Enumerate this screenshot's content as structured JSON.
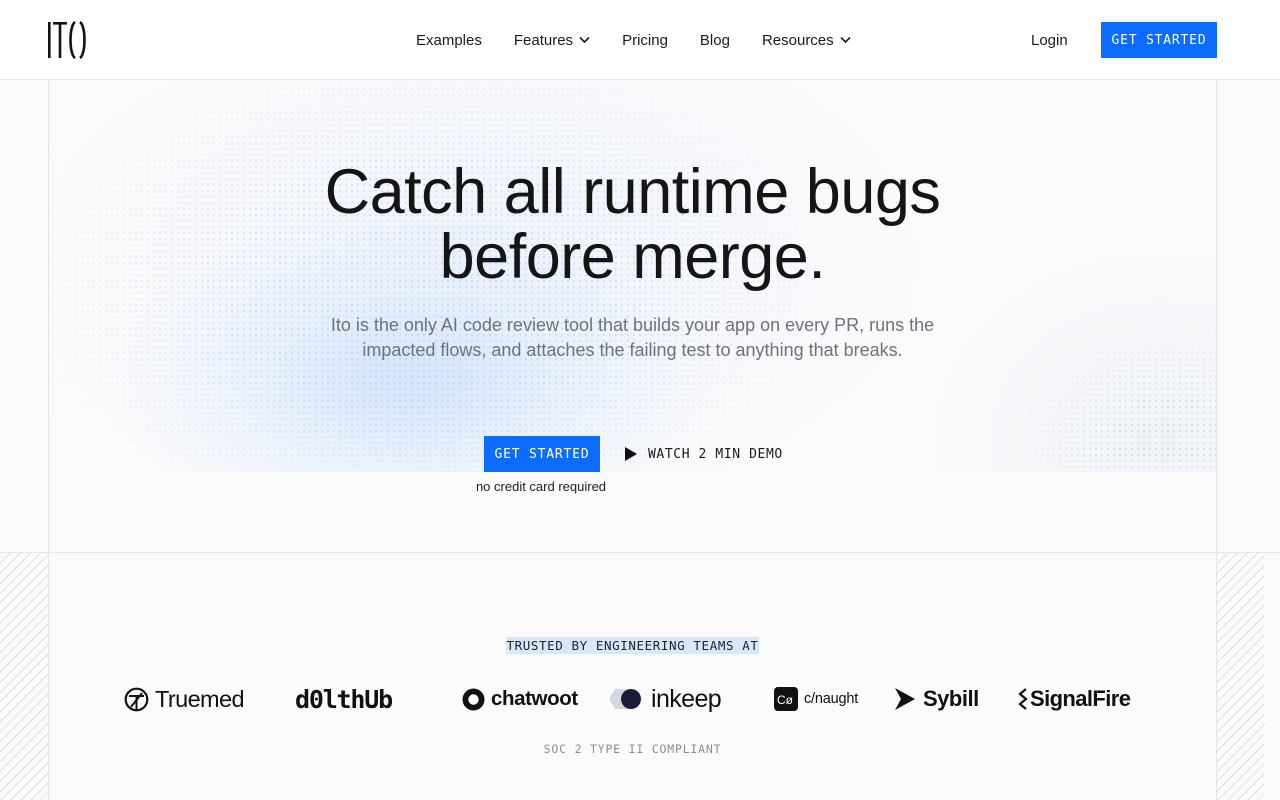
{
  "brand": {
    "logo_text": "ITO"
  },
  "nav": {
    "items": [
      {
        "label": "Examples",
        "has_dropdown": false
      },
      {
        "label": "Features",
        "has_dropdown": true
      },
      {
        "label": "Pricing",
        "has_dropdown": false
      },
      {
        "label": "Blog",
        "has_dropdown": false
      },
      {
        "label": "Resources",
        "has_dropdown": true
      }
    ],
    "login_label": "Login",
    "cta_label": "GET STARTED"
  },
  "hero": {
    "headline_line1": "Catch all runtime bugs",
    "headline_line2": "before merge.",
    "subheadline": "Ito is the only AI code review tool that builds your app on every PR, runs the impacted flows, and attaches the failing test to anything that breaks.",
    "cta_label": "GET STARTED",
    "demo_label": "WATCH 2 MIN DEMO",
    "note": "no credit card required"
  },
  "trusted": {
    "label": "TRUSTED BY ENGINEERING TEAMS AT",
    "logos": [
      {
        "name": "Truemed",
        "icon": "truemed-logo-icon"
      },
      {
        "name": "d0lthUb",
        "icon": "dolthub-wordmark"
      },
      {
        "name": "chatwoot",
        "icon": "chatwoot-logo-icon"
      },
      {
        "name": "inkeep",
        "icon": "inkeep-logo-icon"
      },
      {
        "name": "c/naught",
        "icon": "cnaught-logo-icon"
      },
      {
        "name": "Sybill",
        "icon": "sybill-logo-icon"
      },
      {
        "name": "SignalFire",
        "icon": "signalfire-logo-icon"
      }
    ],
    "compliance": "SOC 2 TYPE II COMPLIANT"
  },
  "colors": {
    "accent": "#0b6cff",
    "text": "#151515",
    "muted": "#6f7278",
    "highlight": "#d8e8fb"
  }
}
